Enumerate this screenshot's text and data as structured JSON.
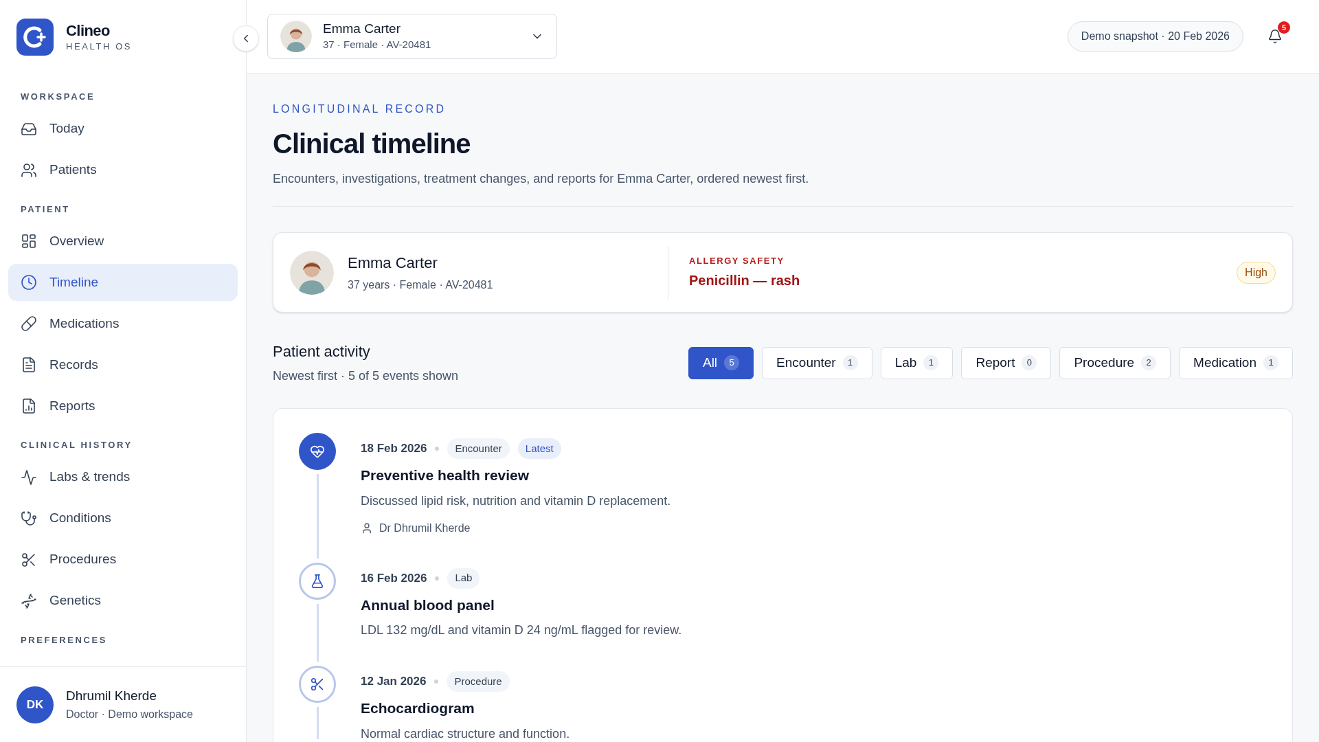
{
  "brand": {
    "name": "Clineo",
    "tagline": "HEALTH OS"
  },
  "sidebar": {
    "sections": [
      {
        "title": "WORKSPACE",
        "items": [
          {
            "label": "Today",
            "selected": false
          },
          {
            "label": "Patients",
            "selected": false
          }
        ]
      },
      {
        "title": "PATIENT",
        "items": [
          {
            "label": "Overview",
            "selected": false
          },
          {
            "label": "Timeline",
            "selected": true
          },
          {
            "label": "Medications",
            "selected": false
          },
          {
            "label": "Records",
            "selected": false
          },
          {
            "label": "Reports",
            "selected": false
          }
        ]
      },
      {
        "title": "CLINICAL HISTORY",
        "items": [
          {
            "label": "Labs & trends",
            "selected": false
          },
          {
            "label": "Conditions",
            "selected": false
          },
          {
            "label": "Procedures",
            "selected": false
          },
          {
            "label": "Genetics",
            "selected": false
          }
        ]
      },
      {
        "title": "PREFERENCES"
      }
    ],
    "user": {
      "initials": "DK",
      "name": "Dhrumil Kherde",
      "role": "Doctor · Demo workspace"
    }
  },
  "header": {
    "patient": {
      "name": "Emma Carter",
      "details": "37 · Female · AV-20481"
    },
    "snapshot": "Demo snapshot · 20 Feb 2026",
    "notifications": "5"
  },
  "page": {
    "eyebrow": "LONGITUDINAL RECORD",
    "title": "Clinical timeline",
    "description": "Encounters, investigations, treatment changes, and reports for Emma Carter, ordered newest first."
  },
  "patient_card": {
    "name": "Emma Carter",
    "details": "37 years · Female · AV-20481",
    "allergy_label": "ALLERGY SAFETY",
    "allergy": "Penicillin — rash",
    "severity": "High"
  },
  "activity": {
    "title": "Patient activity",
    "subtitle": "Newest first · 5 of 5 events shown",
    "filters": [
      {
        "label": "All",
        "count": "5",
        "selected": true
      },
      {
        "label": "Encounter",
        "count": "1",
        "selected": false
      },
      {
        "label": "Lab",
        "count": "1",
        "selected": false
      },
      {
        "label": "Report",
        "count": "0",
        "selected": false
      },
      {
        "label": "Procedure",
        "count": "2",
        "selected": false
      },
      {
        "label": "Medication",
        "count": "1",
        "selected": false
      }
    ],
    "events": [
      {
        "kind": "encounter",
        "selected": true,
        "date": "18 Feb 2026",
        "tags": [
          {
            "label": "Encounter",
            "kind": "category"
          },
          {
            "label": "Latest",
            "kind": "highlight"
          }
        ],
        "title": "Preventive health review",
        "description": "Discussed lipid risk, nutrition and vitamin D replacement.",
        "author": "Dr Dhrumil Kherde"
      },
      {
        "kind": "lab",
        "selected": false,
        "date": "16 Feb 2026",
        "tags": [
          {
            "label": "Lab",
            "kind": "category"
          }
        ],
        "title": "Annual blood panel",
        "description": "LDL 132 mg/dL and vitamin D 24 ng/mL flagged for review."
      },
      {
        "kind": "procedure",
        "selected": false,
        "date": "12 Jan 2026",
        "tags": [
          {
            "label": "Procedure",
            "kind": "category"
          }
        ],
        "title": "Echocardiogram",
        "description": "Normal cardiac structure and function."
      }
    ]
  }
}
